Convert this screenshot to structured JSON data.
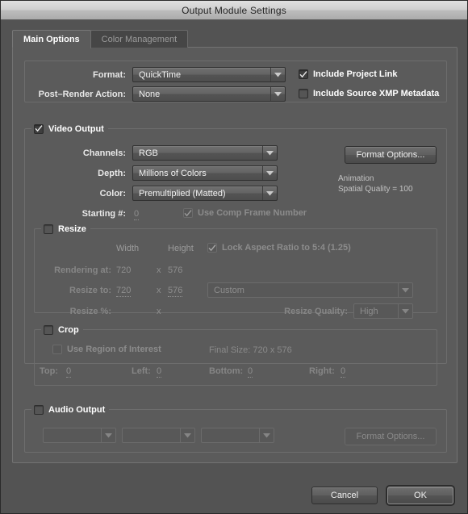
{
  "window": {
    "title": "Output Module Settings"
  },
  "tabs": [
    {
      "label": "Main Options",
      "active": true
    },
    {
      "label": "Color Management",
      "active": false
    }
  ],
  "format_section": {
    "format_label": "Format:",
    "format_value": "QuickTime",
    "post_render_label": "Post–Render Action:",
    "post_render_value": "None",
    "include_project_link": {
      "label": "Include Project Link",
      "checked": true
    },
    "include_xmp": {
      "label": "Include Source XMP Metadata",
      "checked": false
    }
  },
  "video_output": {
    "legend": "Video Output",
    "checked": true,
    "channels_label": "Channels:",
    "channels_value": "RGB",
    "depth_label": "Depth:",
    "depth_value": "Millions of Colors",
    "color_label": "Color:",
    "color_value": "Premultiplied (Matted)",
    "starting_label": "Starting #:",
    "starting_value": "0",
    "use_comp_frame": {
      "label": "Use Comp Frame Number",
      "checked": true
    },
    "format_options_button": "Format Options...",
    "codec_info": "Animation\nSpatial Quality = 100"
  },
  "resize": {
    "legend": "Resize",
    "checked": false,
    "width_header": "Width",
    "height_header": "Height",
    "lock_aspect": {
      "label": "Lock Aspect Ratio to 5:4 (1.25)",
      "checked": true
    },
    "rendering_at_label": "Rendering at:",
    "rendering_width": "720",
    "rendering_x": "x",
    "rendering_height": "576",
    "resize_to_label": "Resize to:",
    "resize_width": "720",
    "resize_x": "x",
    "resize_height": "576",
    "preset_value": "Custom",
    "resize_pct_label": "Resize %:",
    "resize_pct_x": "x",
    "resize_quality_label": "Resize Quality:",
    "resize_quality_value": "High"
  },
  "crop": {
    "legend": "Crop",
    "checked": false,
    "use_region": {
      "label": "Use Region of Interest",
      "checked": false
    },
    "final_size": "Final Size: 720 x 576",
    "top_label": "Top:",
    "top_value": "0",
    "left_label": "Left:",
    "left_value": "0",
    "bottom_label": "Bottom:",
    "bottom_value": "0",
    "right_label": "Right:",
    "right_value": "0"
  },
  "audio_output": {
    "legend": "Audio Output",
    "checked": false,
    "rate_value": "",
    "depth_value": "",
    "channels_value": "",
    "format_options_button": "Format Options..."
  },
  "footer": {
    "cancel_label": "Cancel",
    "ok_label": "OK"
  },
  "colors": {
    "dialog_bg": "#535353",
    "panel_bg": "#5b5b5b",
    "titlebar": "#cfcfcf",
    "text": "#e8e8e8",
    "disabled_text": "#8a8a8a"
  }
}
